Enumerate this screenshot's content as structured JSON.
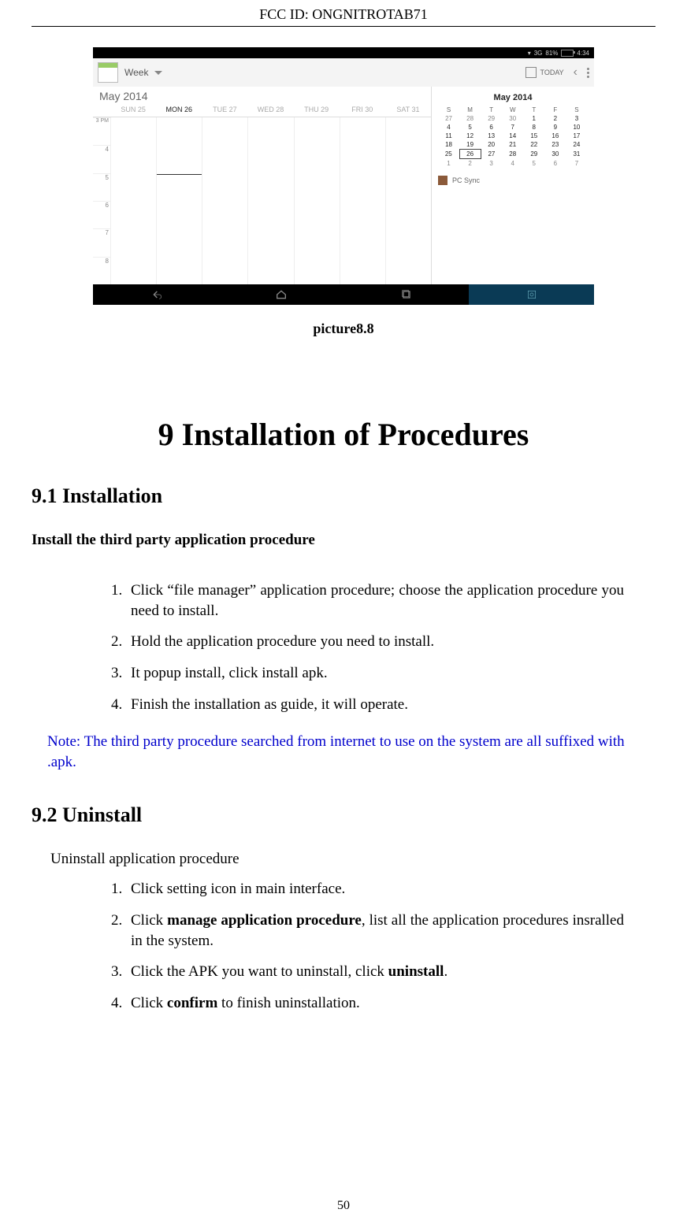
{
  "header": {
    "fcc_label": "FCC ID:",
    "fcc_id": "ONGNITROTAB71"
  },
  "screenshot": {
    "statusbar": {
      "battery_pct": "81%",
      "time": "4:34"
    },
    "appbar": {
      "view_label": "Week",
      "today_label": "TODAY"
    },
    "week": {
      "month_label": "May 2014",
      "days": [
        "SUN 25",
        "MON 26",
        "TUE 27",
        "WED 28",
        "THU 29",
        "FRI 30",
        "SAT 31"
      ],
      "today_index": 1,
      "hours": [
        "3 PM",
        "4",
        "5",
        "6",
        "7",
        "8"
      ]
    },
    "mini": {
      "title": "May 2014",
      "dow": [
        "S",
        "M",
        "T",
        "W",
        "T",
        "F",
        "S"
      ],
      "rows": [
        {
          "cells": [
            "27",
            "28",
            "29",
            "30",
            "1",
            "2",
            "3"
          ],
          "in": [
            false,
            false,
            false,
            false,
            true,
            true,
            true
          ]
        },
        {
          "cells": [
            "4",
            "5",
            "6",
            "7",
            "8",
            "9",
            "10"
          ],
          "in": [
            true,
            true,
            true,
            true,
            true,
            true,
            true
          ]
        },
        {
          "cells": [
            "11",
            "12",
            "13",
            "14",
            "15",
            "16",
            "17"
          ],
          "in": [
            true,
            true,
            true,
            true,
            true,
            true,
            true
          ]
        },
        {
          "cells": [
            "18",
            "19",
            "20",
            "21",
            "22",
            "23",
            "24"
          ],
          "in": [
            true,
            true,
            true,
            true,
            true,
            true,
            true
          ]
        },
        {
          "cells": [
            "25",
            "26",
            "27",
            "28",
            "29",
            "30",
            "31"
          ],
          "in": [
            true,
            true,
            true,
            true,
            true,
            true,
            true
          ],
          "sel": 1
        },
        {
          "cells": [
            "1",
            "2",
            "3",
            "4",
            "5",
            "6",
            "7"
          ],
          "in": [
            false,
            false,
            false,
            false,
            false,
            false,
            false
          ]
        }
      ],
      "pcsync_label": "PC Sync"
    }
  },
  "caption": "picture8.8",
  "chapter_title": "9 Installation of Procedures",
  "sec91": {
    "heading": "9.1 Installation",
    "subhead": "Install the third party application procedure",
    "items": [
      "Click “file manager” application procedure; choose the application procedure you need to install.",
      "Hold the application procedure you need to install.",
      "It popup install, click install apk.",
      "Finish the installation as guide, it will operate."
    ],
    "note": "Note: The third party procedure searched from internet to use on the system are all suffixed with .apk."
  },
  "sec92": {
    "heading": "9.2 Uninstall",
    "subhead": "Uninstall application procedure",
    "items_html": [
      "Click setting icon in main interface.",
      "Click <b>manage application procedure</b>, list all the application procedures insralled in the system.",
      "Click the APK you want to uninstall, click <b>uninstall</b>.",
      "Click <b>confirm</b> to finish uninstallation."
    ]
  },
  "page_number": "50"
}
